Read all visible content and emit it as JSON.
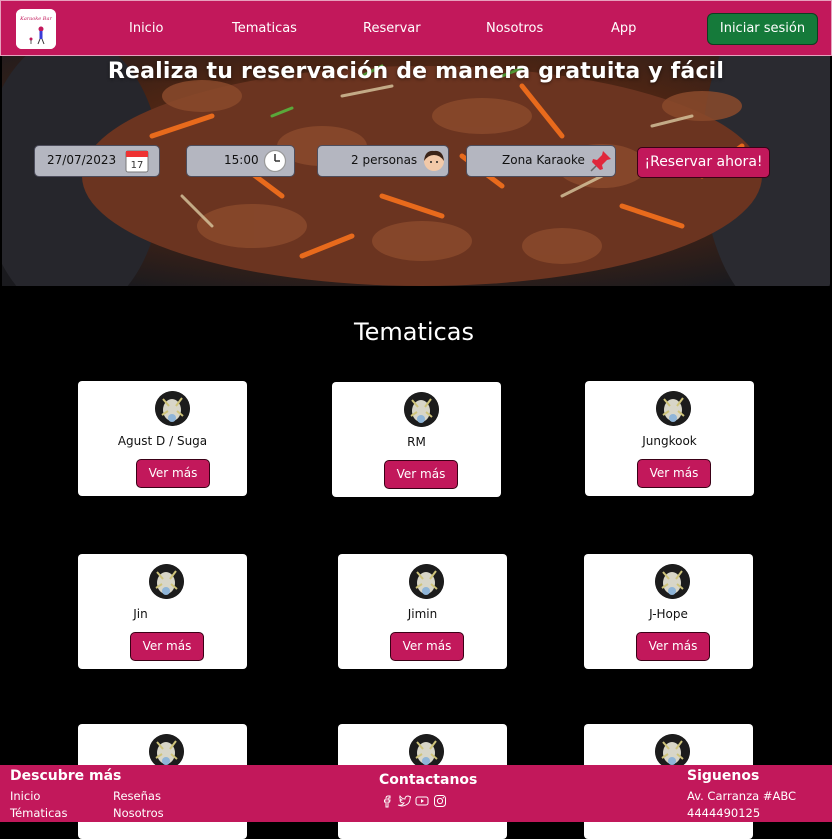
{
  "nav": {
    "logo_label": "logo",
    "links": [
      "Inicio",
      "Tematicas",
      "Reservar",
      "Nosotros",
      "App"
    ],
    "login_label": "Iniciar sesión"
  },
  "hero": {
    "title": "Realiza tu reservación de manera gratuita y fácil",
    "date_value": "27/07/2023",
    "time_value": "15:00",
    "people_value": "2 personas",
    "zone_value": "Zona Karaoke",
    "reserve_label": "¡Reservar ahora!",
    "calendar_day": "17"
  },
  "themes": {
    "title": "Tematicas",
    "cards": [
      {
        "name": "Agust D / Suga",
        "button": "Ver más"
      },
      {
        "name": "RM",
        "button": "Ver más"
      },
      {
        "name": "Jungkook",
        "button": "Ver más"
      },
      {
        "name": "Jin",
        "button": "Ver más"
      },
      {
        "name": "Jimin",
        "button": "Ver más"
      },
      {
        "name": "J-Hope",
        "button": "Ver más"
      },
      {
        "name": "",
        "button": ""
      },
      {
        "name": "",
        "button": ""
      },
      {
        "name": "",
        "button": ""
      }
    ]
  },
  "footer": {
    "discover_title": "Descubre más",
    "discover_links": [
      "Inicio",
      "Reseñas",
      "Tématicas",
      "Nosotros"
    ],
    "contact_title": "Contactanos",
    "social_icons": [
      "facebook-icon",
      "twitter-icon",
      "youtube-icon",
      "instagram-icon"
    ],
    "follow_title": "Siguenos",
    "address": "Av. Carranza #ABC",
    "phone": "4444490125"
  },
  "colors": {
    "brand": "#c2185b",
    "login_green": "#157a3a",
    "background": "#000000"
  }
}
